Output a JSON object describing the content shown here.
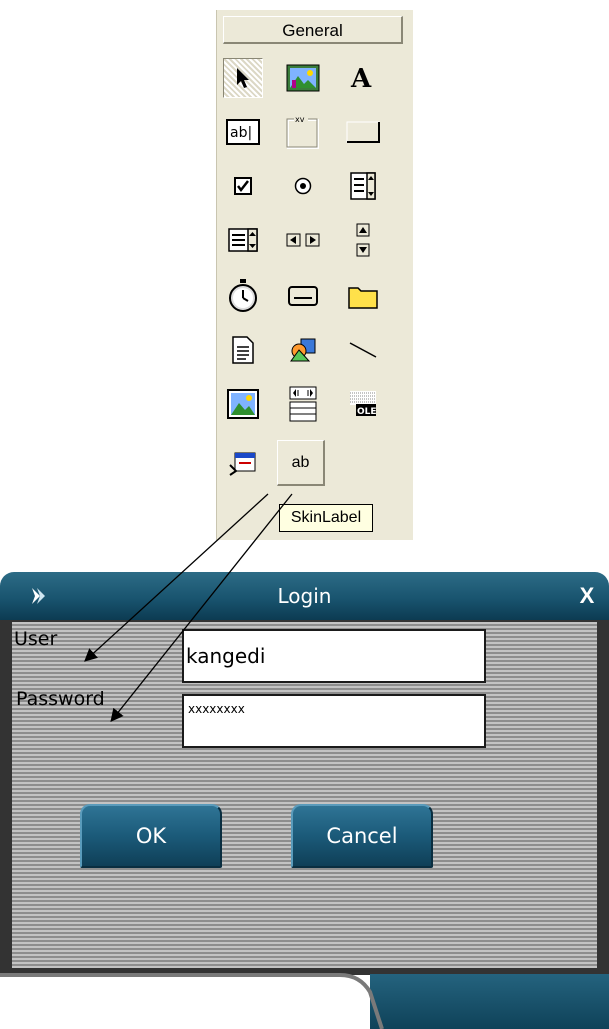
{
  "toolbox": {
    "header_label": "General",
    "tools": [
      {
        "icon": "pointer-icon"
      },
      {
        "icon": "picturebox-icon"
      },
      {
        "icon": "label-icon"
      },
      {
        "icon": "textbox-icon"
      },
      {
        "icon": "frame-icon"
      },
      {
        "icon": "commandbutton-icon"
      },
      {
        "icon": "checkbox-icon"
      },
      {
        "icon": "optionbutton-icon"
      },
      {
        "icon": "combobox-icon"
      },
      {
        "icon": "listbox-icon"
      },
      {
        "icon": "hscrollbar-icon"
      },
      {
        "icon": "vscrollbar-icon"
      },
      {
        "icon": "timer-icon"
      },
      {
        "icon": "drivelistbox-icon"
      },
      {
        "icon": "dirlistbox-icon"
      },
      {
        "icon": "filelistbox-icon"
      },
      {
        "icon": "shape-icon"
      },
      {
        "icon": "line-icon"
      },
      {
        "icon": "image-icon"
      },
      {
        "icon": "data-icon"
      },
      {
        "icon": "ole-icon"
      },
      {
        "icon": "skinform-icon"
      }
    ],
    "skin_label_button": "ab",
    "tooltip": "SkinLabel",
    "tb_text": {
      "textbox": "ab|",
      "frame": "xv",
      "ole": "OLE"
    }
  },
  "login": {
    "title": "Login",
    "close_glyph": "X",
    "user_label": "User",
    "password_label": "Password",
    "user_value": "kangedi",
    "password_value": "xxxxxxxx",
    "ok_label": "OK",
    "cancel_label": "Cancel"
  },
  "colors": {
    "toolbox_bg": "#ece9d8",
    "titlebar": "#19546f",
    "button": "#1b5a79"
  }
}
